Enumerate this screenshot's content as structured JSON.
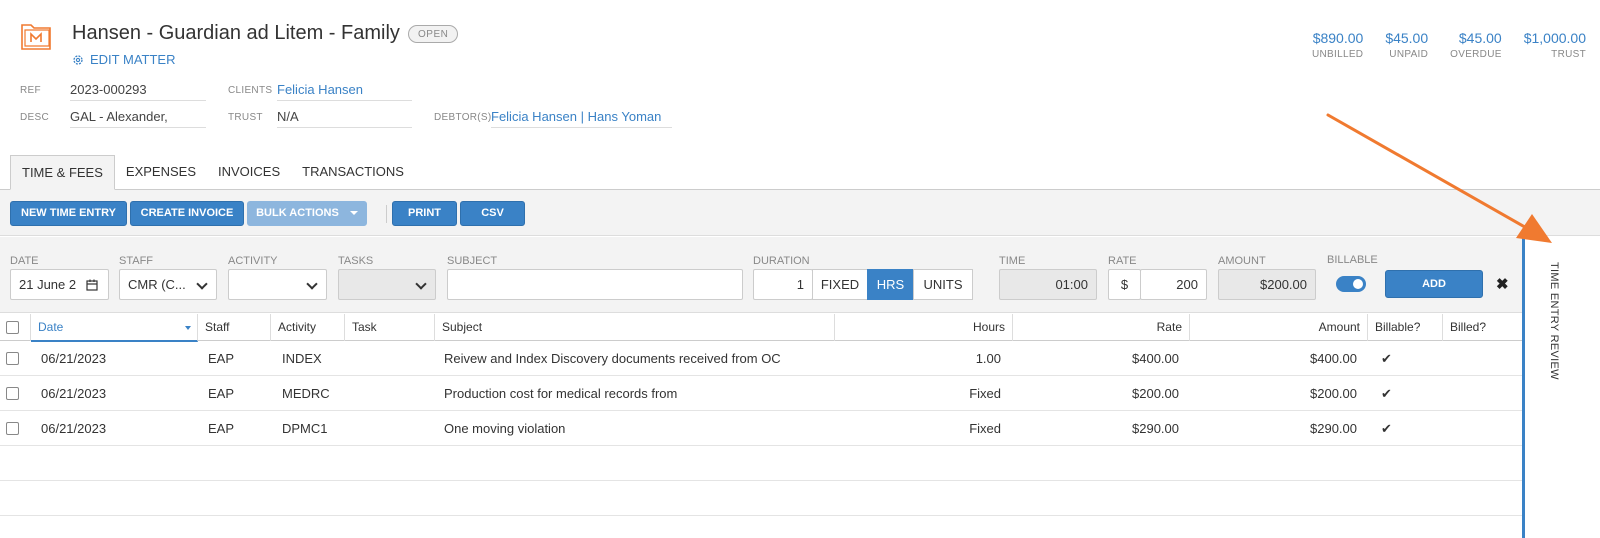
{
  "matter": {
    "title": "Hansen - Guardian ad Litem - Family",
    "status": "OPEN",
    "edit_label": "EDIT MATTER"
  },
  "fields": {
    "ref_label": "REF",
    "ref_value": "2023-000293",
    "desc_label": "DESC",
    "desc_value": "GAL - Alexander,",
    "clients_label": "CLIENTS",
    "clients_value": "Felicia Hansen",
    "trust_label": "TRUST",
    "trust_value": "N/A",
    "debtors_label": "DEBTOR(S)",
    "debtor_1": "Felicia Hansen",
    "debtor_sep": "|",
    "debtor_2": "Hans Yoman"
  },
  "totals": [
    {
      "amount": "$890.00",
      "label": "UNBILLED"
    },
    {
      "amount": "$45.00",
      "label": "UNPAID"
    },
    {
      "amount": "$45.00",
      "label": "OVERDUE"
    },
    {
      "amount": "$1,000.00",
      "label": "TRUST"
    }
  ],
  "tabs": [
    {
      "label": "TIME & FEES",
      "active": true
    },
    {
      "label": "EXPENSES"
    },
    {
      "label": "INVOICES"
    },
    {
      "label": "TRANSACTIONS"
    }
  ],
  "toolbar": {
    "new_time_entry": "NEW TIME ENTRY",
    "create_invoice": "CREATE INVOICE",
    "bulk_actions": "BULK ACTIONS",
    "print": "PRINT",
    "csv": "CSV"
  },
  "entry_form": {
    "date_label": "DATE",
    "date_value": "21 June 2",
    "staff_label": "STAFF",
    "staff_value": "CMR (C...",
    "activity_label": "ACTIVITY",
    "tasks_label": "TASKS",
    "subject_label": "SUBJECT",
    "duration_label": "DURATION",
    "duration_value": "1",
    "fixed_label": "FIXED",
    "hrs_label": "HRS",
    "units_label": "UNITS",
    "time_label": "TIME",
    "time_value": "01:00",
    "rate_label": "RATE",
    "rate_currency": "$",
    "rate_value": "200",
    "amount_label": "AMOUNT",
    "amount_value": "$200.00",
    "billable_label": "BILLABLE",
    "billable_on": true,
    "add_label": "ADD",
    "close_glyph": "✖"
  },
  "table": {
    "headers": {
      "date": "Date",
      "staff": "Staff",
      "activity": "Activity",
      "task": "Task",
      "subject": "Subject",
      "hours": "Hours",
      "rate": "Rate",
      "amount": "Amount",
      "billable": "Billable?",
      "billed": "Billed?"
    },
    "rows": [
      {
        "date": "06/21/2023",
        "staff": "EAP",
        "activity": "INDEX",
        "task": "",
        "subject": "Reivew and Index Discovery documents received from OC",
        "hours": "1.00",
        "rate": "$400.00",
        "amount": "$400.00",
        "billable": "✔",
        "billed": ""
      },
      {
        "date": "06/21/2023",
        "staff": "EAP",
        "activity": "MEDRC",
        "task": "",
        "subject": "Production cost for medical records from",
        "hours": "Fixed",
        "rate": "$200.00",
        "amount": "$200.00",
        "billable": "✔",
        "billed": ""
      },
      {
        "date": "06/21/2023",
        "staff": "EAP",
        "activity": "DPMC1",
        "task": "",
        "subject": "One moving violation",
        "hours": "Fixed",
        "rate": "$290.00",
        "amount": "$290.00",
        "billable": "✔",
        "billed": ""
      }
    ]
  },
  "side_panel": {
    "label": "TIME ENTRY REVIEW"
  },
  "colors": {
    "accent": "#3a82c6",
    "annotation_arrow": "#f07a30",
    "matter_icon": "#f07a30"
  }
}
